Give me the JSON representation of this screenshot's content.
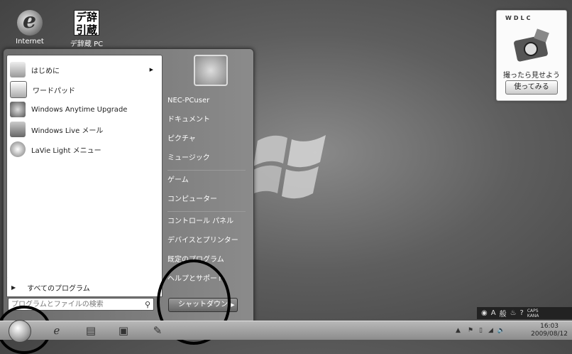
{
  "desktop": {
    "icons": [
      {
        "label": "Internet"
      },
      {
        "label": "デ辞蔵 PC",
        "glyph": "デ辞\n引蔵"
      }
    ]
  },
  "gadget": {
    "brand": "WDLC",
    "caption": "撮ったら見せよう",
    "button": "使ってみる"
  },
  "start_menu": {
    "programs": [
      {
        "label": "はじめに",
        "has_submenu": true
      },
      {
        "label": "ワードパッド"
      },
      {
        "label": "Windows Anytime Upgrade"
      },
      {
        "label": "Windows Live メール"
      },
      {
        "label": "LaVie Light メニュー"
      }
    ],
    "all_programs": "すべてのプログラム",
    "search_placeholder": "プログラムとファイルの検索",
    "places": [
      {
        "label": "NEC-PCuser"
      },
      {
        "label": "ドキュメント"
      },
      {
        "label": "ピクチャ"
      },
      {
        "label": "ミュージック"
      },
      {
        "label": "ゲーム"
      },
      {
        "label": "コンピューター"
      },
      {
        "label": "コントロール パネル"
      },
      {
        "label": "デバイスとプリンター"
      },
      {
        "label": "既定のプログラム"
      },
      {
        "label": "ヘルプとサポート"
      }
    ],
    "shutdown": "シャットダウン"
  },
  "ime_bar": {
    "mode": "A",
    "dictionary": "般",
    "caps": "CAPS",
    "kana": "KANA"
  },
  "taskbar": {
    "clock_time": "16:03",
    "clock_date": "2009/08/12"
  },
  "colors": {
    "annotation": "#000000",
    "taskbar": "#a0a0a0"
  }
}
